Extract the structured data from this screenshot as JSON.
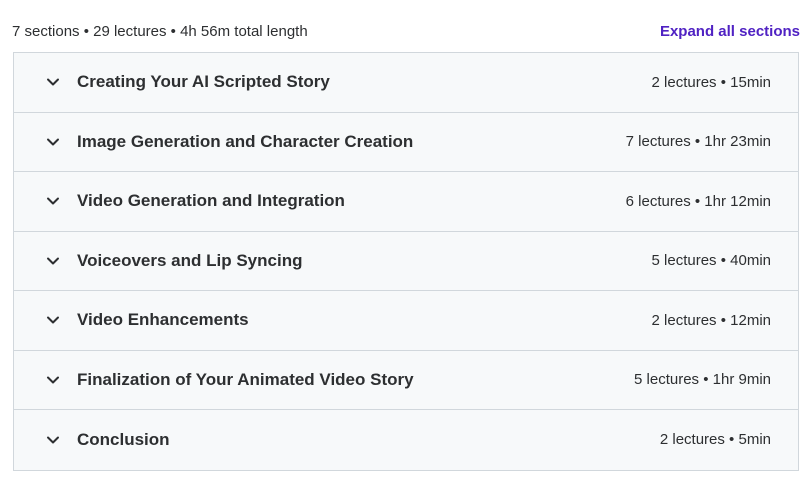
{
  "summary": {
    "text": "7 sections • 29 lectures • 4h 56m total length",
    "expand_label": "Expand all sections"
  },
  "sections": [
    {
      "title": "Creating Your AI Scripted Story",
      "meta": "2 lectures • 15min",
      "icon": "chevron-down-icon"
    },
    {
      "title": "Image Generation and Character Creation",
      "meta": "7 lectures • 1hr 23min",
      "icon": "chevron-down-icon"
    },
    {
      "title": "Video Generation and Integration",
      "meta": "6 lectures • 1hr 12min",
      "icon": "chevron-down-icon"
    },
    {
      "title": "Voiceovers and Lip Syncing",
      "meta": "5 lectures • 40min",
      "icon": "chevron-down-icon"
    },
    {
      "title": "Video Enhancements",
      "meta": "2 lectures • 12min",
      "icon": "chevron-down-icon"
    },
    {
      "title": "Finalization of Your Animated Video Story",
      "meta": "5 lectures • 1hr 9min",
      "icon": "chevron-down-icon"
    },
    {
      "title": "Conclusion",
      "meta": "2 lectures • 5min",
      "icon": "chevron-down-icon"
    }
  ],
  "colors": {
    "accent": "#5022c3",
    "text": "#2d2f31",
    "section_bg": "#f7f9fa",
    "border": "#d1d7dc"
  }
}
